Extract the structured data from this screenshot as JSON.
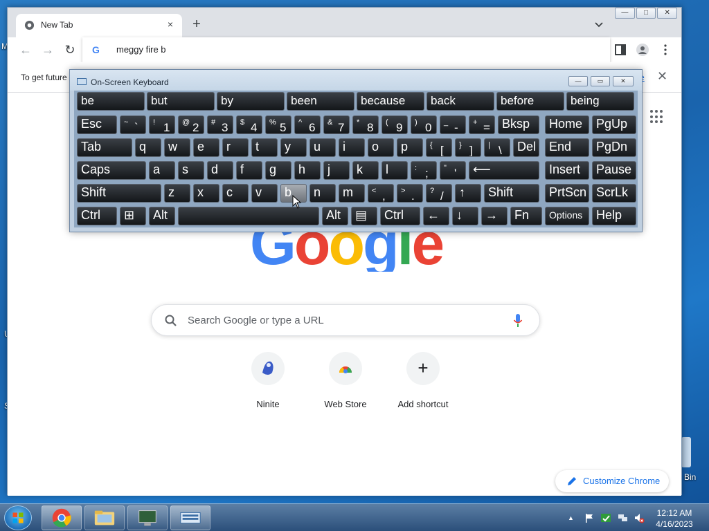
{
  "desktop": {
    "fragments": [
      "M",
      "U",
      "S",
      "Bin"
    ]
  },
  "chrome": {
    "tab_title": "New Tab",
    "tab_close": "×",
    "new_tab": "+",
    "tab_search": "⌄",
    "window_controls": {
      "minimize": "—",
      "maximize": "□",
      "close": "✕"
    },
    "omnibox_text": "meggy fire b",
    "infobar": {
      "text": "To get future",
      "link": "e",
      "close": "✕"
    },
    "search_placeholder": "Search Google or type a URL",
    "shortcuts": [
      {
        "label": "Ninite",
        "icon": "ninite-icon"
      },
      {
        "label": "Web Store",
        "icon": "web-store-icon"
      },
      {
        "label": "Add shortcut",
        "icon": "plus-icon",
        "glyph": "+"
      }
    ],
    "customize_label": "Customize Chrome",
    "logo": {
      "letters": [
        "G",
        "o",
        "o",
        "g",
        "l",
        "e"
      ],
      "colors": [
        "#4285f4",
        "#ea4335",
        "#fbbc05",
        "#4285f4",
        "#34a853",
        "#ea4335"
      ]
    }
  },
  "osk": {
    "title": "On-Screen Keyboard",
    "controls": {
      "minimize": "—",
      "restore": "▭",
      "close": "✕"
    },
    "predictions": [
      "be",
      "but",
      "by",
      "been",
      "because",
      "back",
      "before",
      "being"
    ],
    "rows": [
      [
        {
          "label": "Esc"
        },
        {
          "shift": "~",
          "main": "`"
        },
        {
          "shift": "!",
          "main": "1"
        },
        {
          "shift": "@",
          "main": "2"
        },
        {
          "shift": "#",
          "main": "3"
        },
        {
          "shift": "$",
          "main": "4"
        },
        {
          "shift": "%",
          "main": "5"
        },
        {
          "shift": "^",
          "main": "6"
        },
        {
          "shift": "&",
          "main": "7"
        },
        {
          "shift": "*",
          "main": "8"
        },
        {
          "shift": "(",
          "main": "9"
        },
        {
          "shift": ")",
          "main": "0"
        },
        {
          "shift": "_",
          "main": "-"
        },
        {
          "shift": "+",
          "main": "="
        },
        {
          "label": "Bksp"
        },
        {
          "label": "Home"
        },
        {
          "label": "PgUp"
        }
      ],
      [
        {
          "label": "Tab"
        },
        {
          "label": "q"
        },
        {
          "label": "w"
        },
        {
          "label": "e"
        },
        {
          "label": "r"
        },
        {
          "label": "t"
        },
        {
          "label": "y"
        },
        {
          "label": "u"
        },
        {
          "label": "i"
        },
        {
          "label": "o"
        },
        {
          "label": "p"
        },
        {
          "shift": "{",
          "main": "["
        },
        {
          "shift": "}",
          "main": "]"
        },
        {
          "shift": "|",
          "main": "\\"
        },
        {
          "label": "Del"
        },
        {
          "label": "End"
        },
        {
          "label": "PgDn"
        }
      ],
      [
        {
          "label": "Caps"
        },
        {
          "label": "a"
        },
        {
          "label": "s"
        },
        {
          "label": "d"
        },
        {
          "label": "f"
        },
        {
          "label": "g"
        },
        {
          "label": "h"
        },
        {
          "label": "j"
        },
        {
          "label": "k"
        },
        {
          "label": "l"
        },
        {
          "shift": ":",
          "main": ";"
        },
        {
          "shift": "\"",
          "main": "'"
        },
        {
          "label": "⟵"
        },
        {
          "label": "Insert"
        },
        {
          "label": "Pause"
        }
      ],
      [
        {
          "label": "Shift"
        },
        {
          "label": "z"
        },
        {
          "label": "x"
        },
        {
          "label": "c"
        },
        {
          "label": "v"
        },
        {
          "label": "b"
        },
        {
          "label": "n"
        },
        {
          "label": "m"
        },
        {
          "shift": "<",
          "main": ","
        },
        {
          "shift": ">",
          "main": "."
        },
        {
          "shift": "?",
          "main": "/"
        },
        {
          "label": "↑"
        },
        {
          "label": "Shift"
        },
        {
          "label": "PrtScn"
        },
        {
          "label": "ScrLk"
        }
      ],
      [
        {
          "label": "Ctrl"
        },
        {
          "label": "⊞"
        },
        {
          "label": "Alt"
        },
        {
          "label": ""
        },
        {
          "label": "Alt"
        },
        {
          "label": "▤"
        },
        {
          "label": "Ctrl"
        },
        {
          "label": "←"
        },
        {
          "label": "↓"
        },
        {
          "label": "→"
        },
        {
          "label": "Fn"
        },
        {
          "label": "Options"
        },
        {
          "label": "Help"
        }
      ]
    ]
  },
  "taskbar": {
    "time": "12:12 AM",
    "date": "4/16/2023",
    "tray_arrow": "▲"
  }
}
